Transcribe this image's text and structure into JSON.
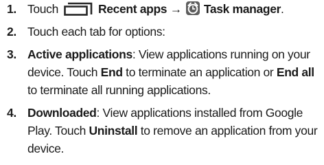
{
  "icons": {
    "recent_apps": "recent-apps-icon",
    "task_manager": "task-manager-icon"
  },
  "steps": [
    {
      "number": "1.",
      "touch": "Touch",
      "recent_apps": "Recent apps",
      "arrow": "→",
      "task_manager": "Task manager",
      "end": "."
    },
    {
      "number": "2.",
      "text": "Touch each tab for options:"
    },
    {
      "number": "3.",
      "heading": "Active applications",
      "text_a": ": View applications running on your device. Touch ",
      "end_label": "End",
      "text_b": " to terminate an application or ",
      "end_all_label": "End all",
      "text_c": " to terminate all running applications."
    },
    {
      "number": "4.",
      "heading": "Downloaded",
      "text_a": ": View applications installed from Google Play. Touch ",
      "uninstall_label": "Uninstall",
      "text_b": " to remove an application from your device."
    }
  ]
}
